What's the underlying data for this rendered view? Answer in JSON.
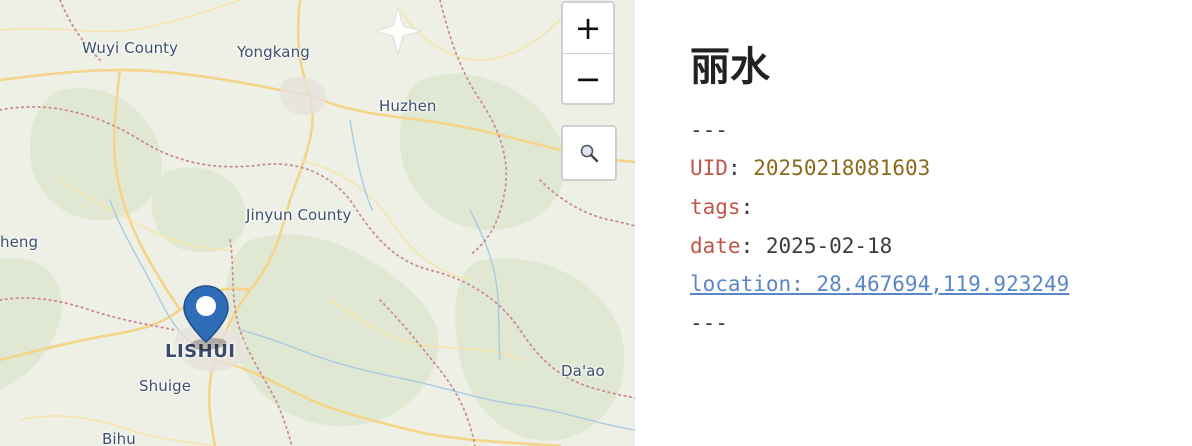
{
  "map": {
    "places": [
      {
        "name": "Wuyi County",
        "kind": "town"
      },
      {
        "name": "Yongkang",
        "kind": "town"
      },
      {
        "name": "Huzhen",
        "kind": "town"
      },
      {
        "name": "Jinyun County",
        "kind": "town"
      },
      {
        "name": "heng",
        "kind": "town"
      },
      {
        "name": "LISHUI",
        "kind": "city"
      },
      {
        "name": "Shuige",
        "kind": "town"
      },
      {
        "name": "Da'ao",
        "kind": "town"
      },
      {
        "name": "Bihu",
        "kind": "town"
      }
    ],
    "controls": {
      "zoom_in": "+",
      "zoom_out": "−",
      "search_icon": "search-icon"
    },
    "marker_icon": "map-pin-icon",
    "colors": {
      "land": "#eef0e6",
      "forest": "#dfe7d2",
      "road": "#f5d98c",
      "boundary": "#c98b95",
      "river": "#9cc2e0",
      "marker": "#2f6db8"
    }
  },
  "note": {
    "title": "丽水",
    "separator_top": "---",
    "uid_key": "UID",
    "uid_value": "20250218081603",
    "tags_key": "tags",
    "date_key": "date",
    "date_value": "2025-02-18",
    "location_text": "location: 28.467694,119.923249",
    "separator_bottom": "---",
    "colon": ":",
    "colors": {
      "key": "#c0574b",
      "number": "#8a6a1c",
      "link": "#5a86c6"
    }
  }
}
